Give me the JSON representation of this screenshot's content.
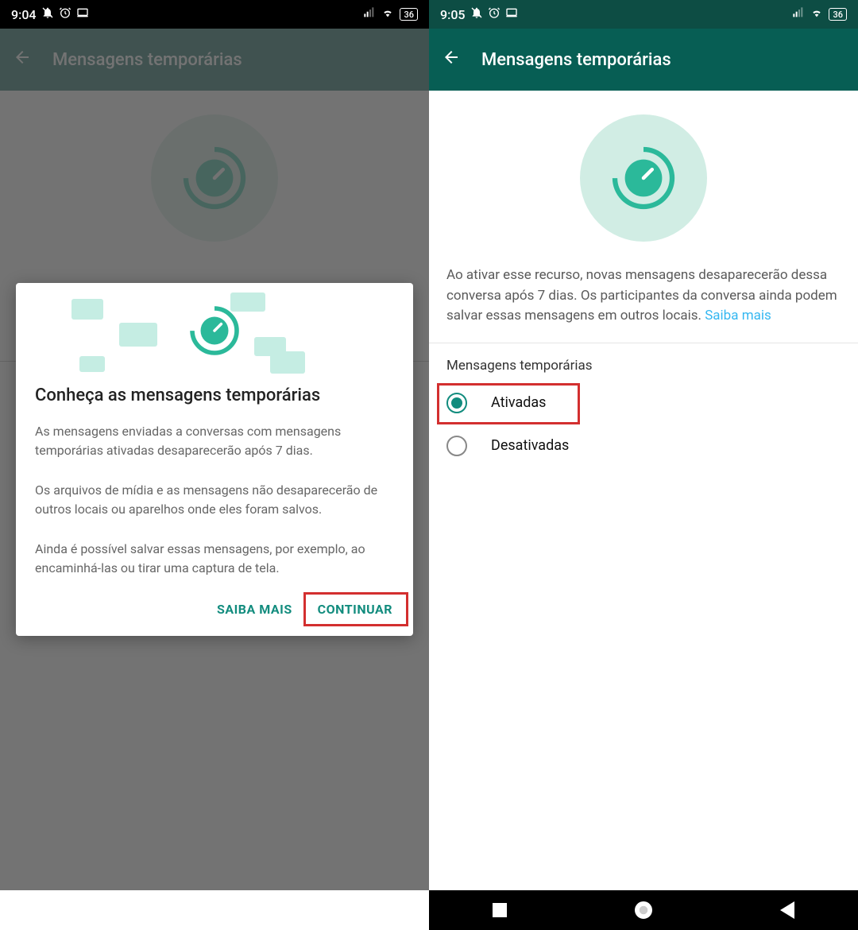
{
  "left": {
    "status": {
      "time": "9:04",
      "battery": "36"
    },
    "header": {
      "title": "Mensagens temporárias"
    },
    "dialog": {
      "title": "Conheça as mensagens temporárias",
      "p1": "As mensagens enviadas a conversas com mensagens temporárias ativadas desaparecerão após 7 dias.",
      "p2": "Os arquivos de mídia e as mensagens não desaparecerão de outros locais ou aparelhos onde eles foram salvos.",
      "p3": "Ainda é possível salvar essas mensagens, por exemplo, ao encaminhá-las ou tirar uma captura de tela.",
      "learn_more": "SAIBA MAIS",
      "continue": "CONTINUAR"
    }
  },
  "right": {
    "status": {
      "time": "9:05",
      "battery": "36"
    },
    "header": {
      "title": "Mensagens temporárias"
    },
    "description": "Ao ativar esse recurso, novas mensagens desaparecerão dessa conversa após 7 dias. Os participantes da conversa ainda podem salvar essas mensagens em outros locais. ",
    "learn_more": "Saiba mais",
    "section_title": "Mensagens temporárias",
    "options": {
      "on": "Ativadas",
      "off": "Desativadas"
    }
  }
}
